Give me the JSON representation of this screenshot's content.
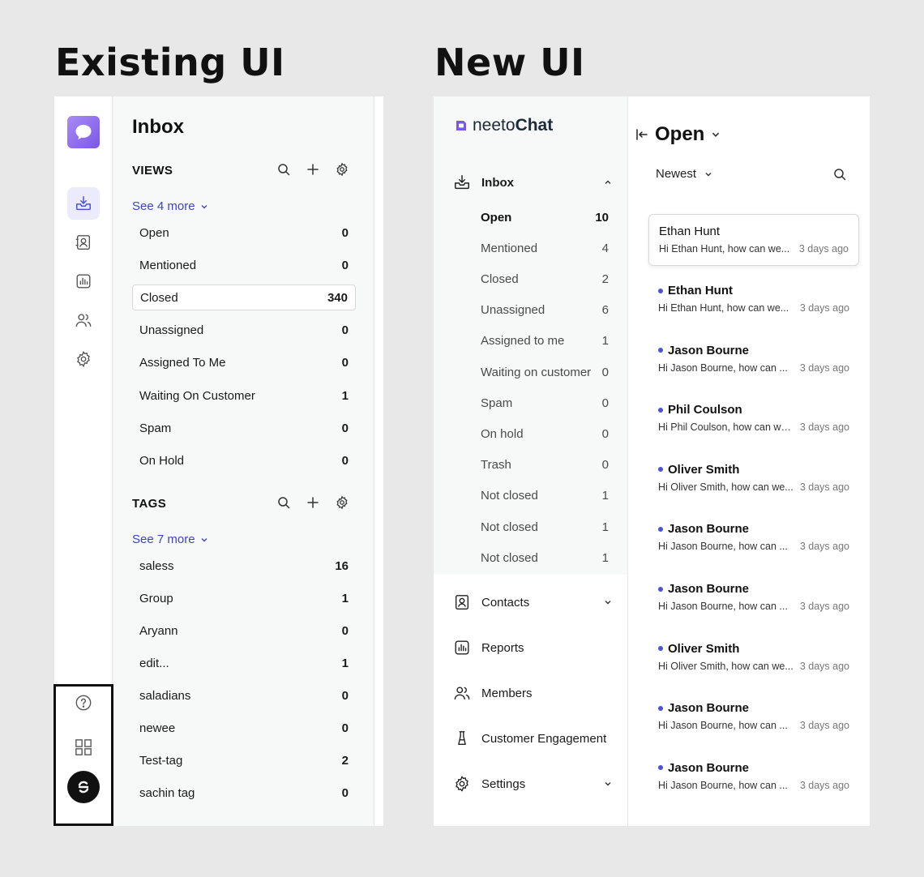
{
  "headings": {
    "existing": "Existing UI",
    "new": "New UI"
  },
  "existing": {
    "title": "Inbox",
    "views": {
      "label": "VIEWS",
      "see_more": "See 4 more",
      "items": [
        {
          "label": "Open",
          "count": "0"
        },
        {
          "label": "Mentioned",
          "count": "0"
        },
        {
          "label": "Closed",
          "count": "340",
          "selected": true
        },
        {
          "label": "Unassigned",
          "count": "0"
        },
        {
          "label": "Assigned To Me",
          "count": "0"
        },
        {
          "label": "Waiting On Customer",
          "count": "1"
        },
        {
          "label": "Spam",
          "count": "0"
        },
        {
          "label": "On Hold",
          "count": "0"
        }
      ]
    },
    "tags": {
      "label": "TAGS",
      "see_more": "See 7 more",
      "items": [
        {
          "label": "saless",
          "count": "16"
        },
        {
          "label": "Group",
          "count": "1"
        },
        {
          "label": "Aryann",
          "count": "0"
        },
        {
          "label": "edit...",
          "count": "1"
        },
        {
          "label": "saladians",
          "count": "0"
        },
        {
          "label": "newee",
          "count": "0"
        },
        {
          "label": "Test-tag",
          "count": "2"
        },
        {
          "label": "sachin tag",
          "count": "0"
        }
      ]
    },
    "rail_icons": [
      "inbox-icon",
      "contacts-icon",
      "reports-icon",
      "members-icon",
      "settings-icon"
    ],
    "bottom_icons": [
      "help-icon",
      "apps-grid-icon",
      "avatar"
    ]
  },
  "new": {
    "brand": {
      "prefix": "neeto",
      "suffix": "Chat"
    },
    "inbox": {
      "label": "Inbox",
      "items": [
        {
          "label": "Open",
          "count": "10",
          "active": true
        },
        {
          "label": "Mentioned",
          "count": "4"
        },
        {
          "label": "Closed",
          "count": "2"
        },
        {
          "label": "Unassigned",
          "count": "6"
        },
        {
          "label": "Assigned to me",
          "count": "1"
        },
        {
          "label": "Waiting on customer",
          "count": "0"
        },
        {
          "label": "Spam",
          "count": "0"
        },
        {
          "label": "On hold",
          "count": "0"
        },
        {
          "label": "Trash",
          "count": "0"
        },
        {
          "label": "Not closed",
          "count": "1"
        },
        {
          "label": "Not closed",
          "count": "1"
        },
        {
          "label": "Not closed",
          "count": "1"
        }
      ]
    },
    "nav": [
      {
        "label": "Contacts",
        "chevron": true
      },
      {
        "label": "Reports",
        "chevron": false
      },
      {
        "label": "Members",
        "chevron": false
      },
      {
        "label": "Customer Engagement",
        "chevron": false
      },
      {
        "label": "Settings",
        "chevron": true
      }
    ],
    "list_title": "Open",
    "sort_label": "Newest",
    "conversations": [
      {
        "name": "Ethan Hunt",
        "preview": "Hi Ethan Hunt, how can we...",
        "time": "3 days ago",
        "unread": false
      },
      {
        "name": "Ethan Hunt",
        "preview": "Hi Ethan Hunt, how can we...",
        "time": "3 days ago",
        "unread": true
      },
      {
        "name": "Jason Bourne",
        "preview": "Hi Jason Bourne, how can ...",
        "time": "3 days ago",
        "unread": true
      },
      {
        "name": "Phil Coulson",
        "preview": "Hi Phil Coulson, how can we...",
        "time": "3 days ago",
        "unread": true
      },
      {
        "name": "Oliver Smith",
        "preview": "Hi Oliver Smith, how can we...",
        "time": "3 days ago",
        "unread": true
      },
      {
        "name": "Jason Bourne",
        "preview": "Hi Jason Bourne, how can ...",
        "time": "3 days ago",
        "unread": true
      },
      {
        "name": "Jason Bourne",
        "preview": "Hi Jason Bourne, how can ...",
        "time": "3 days ago",
        "unread": true
      },
      {
        "name": "Oliver Smith",
        "preview": "Hi Oliver Smith, how can we...",
        "time": "3 days ago",
        "unread": true
      },
      {
        "name": "Jason Bourne",
        "preview": "Hi Jason Bourne, how can ...",
        "time": "3 days ago",
        "unread": true
      },
      {
        "name": "Jason Bourne",
        "preview": "Hi Jason Bourne, how can ...",
        "time": "3 days ago",
        "unread": true
      }
    ],
    "colors": {
      "accent": "#4b52d8",
      "brand": "#7b57e6"
    }
  }
}
